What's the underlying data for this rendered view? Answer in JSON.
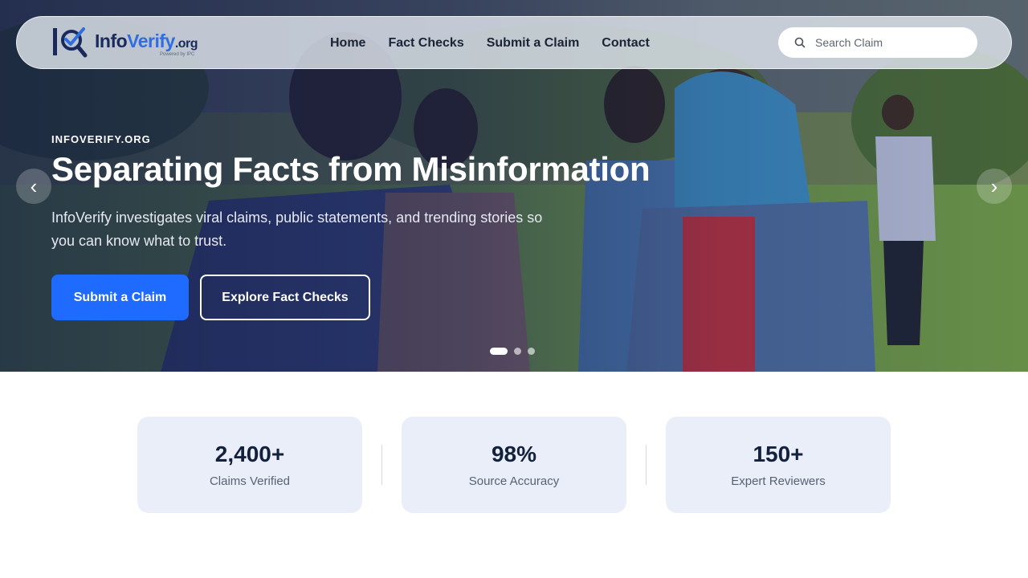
{
  "brand": {
    "name_part1": "Info",
    "name_part2": "Verify",
    "name_suffix": ".org",
    "tagline": "Powered by IPC",
    "logo_icon": "magnifier-check-logo-icon",
    "primary_color": "#1f6bff",
    "dark_color": "#1b2a5c"
  },
  "nav": {
    "items": [
      {
        "label": "Home"
      },
      {
        "label": "Fact Checks"
      },
      {
        "label": "Submit a Claim"
      },
      {
        "label": "Contact"
      }
    ],
    "search": {
      "placeholder": "Search Claim",
      "icon": "search-icon"
    }
  },
  "hero": {
    "eyebrow": "INFOVERIFY.ORG",
    "headline": "Separating Facts from Misinformation",
    "subtext": "InfoVerify investigates viral claims, public statements, and trending stories so you can know what to trust.",
    "primary_cta": "Submit a Claim",
    "secondary_cta": "Explore Fact Checks",
    "prev_arrow": "‹",
    "next_arrow": "›",
    "slides_count": 3,
    "active_slide": 1
  },
  "stats": [
    {
      "value": "2,400+",
      "label": "Claims Verified"
    },
    {
      "value": "98%",
      "label": "Source Accuracy"
    },
    {
      "value": "150+",
      "label": "Expert Reviewers"
    }
  ]
}
